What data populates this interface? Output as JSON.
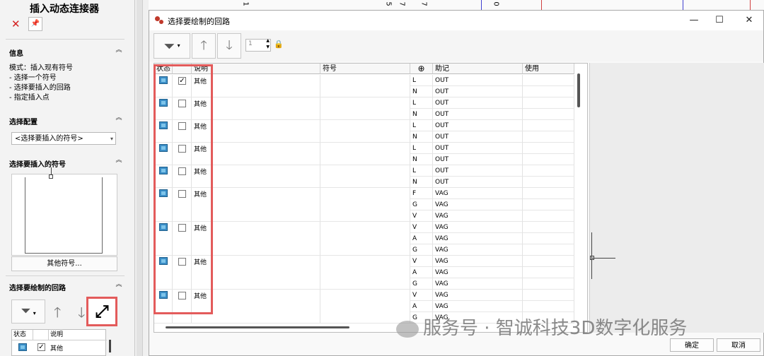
{
  "left_panel": {
    "title": "插入动态连接器",
    "info_section": "信息",
    "info_lines": [
      "模式：插入现有符号",
      "- 选择一个符号",
      "- 选择要插入的回路",
      "- 指定插入点"
    ],
    "config_section": "选择配置",
    "config_value": "<选择要插入的符号>",
    "symbol_section": "选择要插入的符号",
    "other_symbol_button": "其他符号...",
    "circuit_section": "选择要绘制的回路",
    "mini_table": {
      "headers": [
        "状态",
        "说明"
      ],
      "row_desc": "其他"
    }
  },
  "dialog": {
    "title": "选择要绘制的回路",
    "window_buttons": {
      "minimize": "—",
      "maximize": "☐",
      "close": "✕"
    },
    "toolbar": {
      "spinner_value": "1"
    },
    "table": {
      "headers": [
        "状态",
        "说明",
        "符号",
        "助记",
        "使用"
      ],
      "groups": [
        {
          "checked": true,
          "desc": "其他",
          "pins": [
            [
              "L",
              "OUT"
            ],
            [
              "N",
              "OUT"
            ]
          ]
        },
        {
          "checked": false,
          "desc": "其他",
          "pins": [
            [
              "L",
              "OUT"
            ],
            [
              "N",
              "OUT"
            ]
          ]
        },
        {
          "checked": false,
          "desc": "其他",
          "pins": [
            [
              "L",
              "OUT"
            ],
            [
              "N",
              "OUT"
            ]
          ]
        },
        {
          "checked": false,
          "desc": "其他",
          "pins": [
            [
              "L",
              "OUT"
            ],
            [
              "N",
              "OUT"
            ]
          ]
        },
        {
          "checked": false,
          "desc": "其他",
          "pins": [
            [
              "L",
              "OUT"
            ],
            [
              "N",
              "OUT"
            ]
          ]
        },
        {
          "checked": false,
          "desc": "其他",
          "pins": [
            [
              "F",
              "VAG"
            ],
            [
              "G",
              "VAG"
            ],
            [
              "V",
              "VAG"
            ]
          ]
        },
        {
          "checked": false,
          "desc": "其他",
          "pins": [
            [
              "V",
              "VAG"
            ],
            [
              "A",
              "VAG"
            ],
            [
              "G",
              "VAG"
            ]
          ]
        },
        {
          "checked": false,
          "desc": "其他",
          "pins": [
            [
              "V",
              "VAG"
            ],
            [
              "A",
              "VAG"
            ],
            [
              "G",
              "VAG"
            ]
          ]
        },
        {
          "checked": false,
          "desc": "其他",
          "pins": [
            [
              "V",
              "VAG"
            ],
            [
              "A",
              "VAG"
            ],
            [
              "G",
              "VAG"
            ]
          ]
        }
      ]
    },
    "ok_button": "确定",
    "cancel_button": "取消"
  },
  "ruler_marks": [
    "1",
    "5",
    "7",
    "7",
    "0"
  ],
  "watermark": "服务号 · 智诚科技3D数字化服务"
}
